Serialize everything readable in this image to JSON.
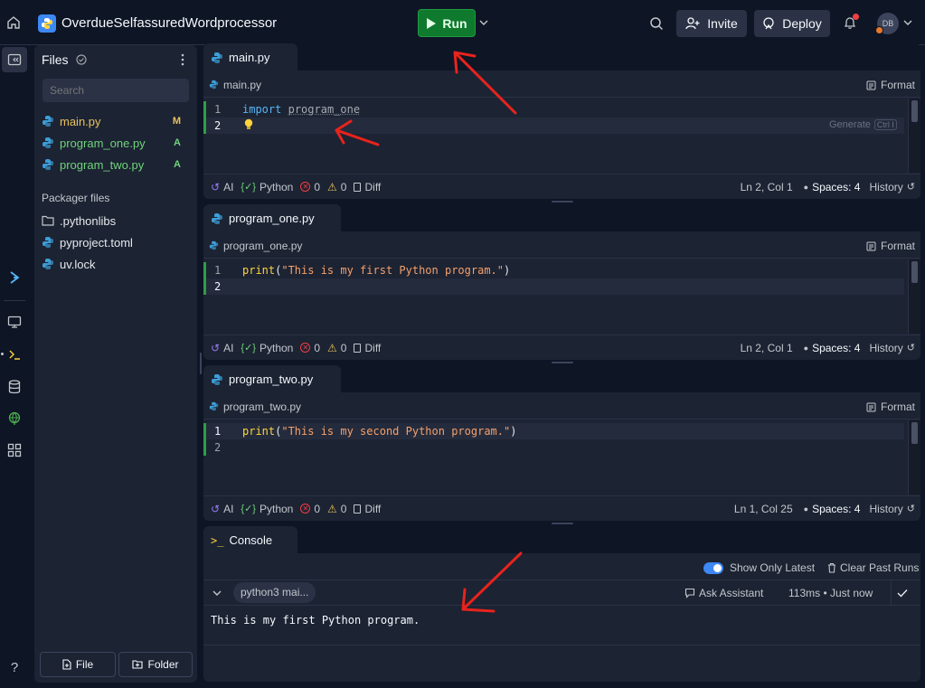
{
  "app": {
    "repl_name": "OverdueSelfassuredWordprocessor",
    "run_label": "Run",
    "invite_label": "Invite",
    "deploy_label": "Deploy",
    "avatar_initials": "DB"
  },
  "files_panel": {
    "title": "Files",
    "search_placeholder": "Search",
    "files": [
      {
        "name": "main.py",
        "badge": "M",
        "color": "#e8c25c",
        "badge_color": "#e8c25c"
      },
      {
        "name": "program_one.py",
        "badge": "A",
        "color": "#6fd37a",
        "badge_color": "#6fd37a"
      },
      {
        "name": "program_two.py",
        "badge": "A",
        "color": "#6fd37a",
        "badge_color": "#6fd37a"
      }
    ],
    "packager_title": "Packager files",
    "packager_files": [
      {
        "name": ".pythonlibs",
        "icon": "folder-icon"
      },
      {
        "name": "pyproject.toml",
        "icon": "python-icon"
      },
      {
        "name": "uv.lock",
        "icon": "python-icon"
      }
    ],
    "new_file_label": "File",
    "new_folder_label": "Folder"
  },
  "editors": [
    {
      "tab": "main.py",
      "crumb": "main.py",
      "format_label": "Format",
      "lines": [
        "1",
        "2"
      ],
      "generate_hint": "Generate",
      "generate_keys": "Ctrl I",
      "status": {
        "ai": "AI",
        "lang": "Python",
        "errors": "0",
        "warnings": "0",
        "diff": "Diff",
        "position": "Ln 2, Col 1",
        "spaces": "Spaces: 4",
        "history": "History"
      }
    },
    {
      "tab": "program_one.py",
      "crumb": "program_one.py",
      "format_label": "Format",
      "lines": [
        "1",
        "2"
      ],
      "status": {
        "ai": "AI",
        "lang": "Python",
        "errors": "0",
        "warnings": "0",
        "diff": "Diff",
        "position": "Ln 2, Col 1",
        "spaces": "Spaces: 4",
        "history": "History"
      }
    },
    {
      "tab": "program_two.py",
      "crumb": "program_two.py",
      "format_label": "Format",
      "lines": [
        "1",
        "2"
      ],
      "status": {
        "ai": "AI",
        "lang": "Python",
        "errors": "0",
        "warnings": "0",
        "diff": "Diff",
        "position": "Ln 1, Col 25",
        "spaces": "Spaces: 4",
        "history": "History"
      }
    }
  ],
  "code": {
    "main_kw": "import",
    "main_mod": "program_one",
    "one_fn": "print",
    "one_open": "(",
    "one_str": "\"This is my first Python program.\"",
    "one_close": ")",
    "two_fn": "print",
    "two_open": "(",
    "two_str": "\"This is my second Python program.\"",
    "two_close": ")"
  },
  "console": {
    "tab": "Console",
    "show_only_latest": "Show Only Latest",
    "clear_past_runs": "Clear Past Runs",
    "run_chip": "python3 mai...",
    "ask_assistant": "Ask Assistant",
    "run_meta": "113ms • Just now",
    "output": "This is my first Python program."
  },
  "colors": {
    "run_green": "#0f7a2d",
    "annotation_red": "#e8231c",
    "accent_blue": "#3d88f5"
  }
}
